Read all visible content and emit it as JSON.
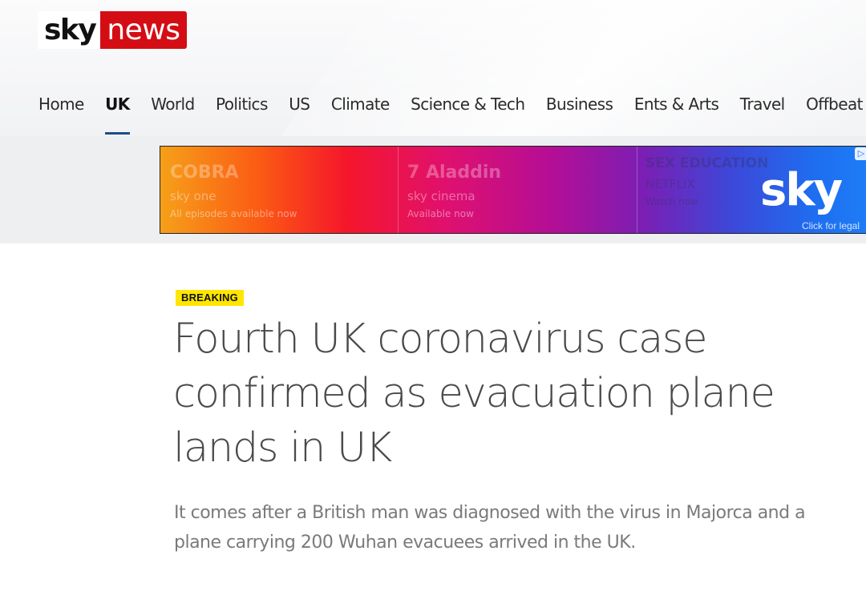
{
  "logo": {
    "part1": "sky",
    "part2": "news"
  },
  "nav": {
    "items": [
      {
        "label": "Home"
      },
      {
        "label": "UK"
      },
      {
        "label": "World"
      },
      {
        "label": "Politics"
      },
      {
        "label": "US"
      },
      {
        "label": "Climate"
      },
      {
        "label": "Science & Tech"
      },
      {
        "label": "Business"
      },
      {
        "label": "Ents & Arts"
      },
      {
        "label": "Travel"
      },
      {
        "label": "Offbeat"
      }
    ],
    "active": "UK"
  },
  "ad": {
    "panel1": {
      "title": "COBRA",
      "channel": "sky one",
      "note": "All episodes available now"
    },
    "panel2": {
      "title": "7 Aladdin",
      "channel": "sky cinema",
      "note": "Available now"
    },
    "panel3": {
      "title": "SEX EDUCATION",
      "channel": "NETFLIX",
      "note": "Watch now"
    },
    "brand": "sky",
    "legal": "Click for legal",
    "corner_icon": "adchoices-icon"
  },
  "article": {
    "badge": "BREAKING",
    "headline": "Fourth UK coronavirus case confirmed as evacuation plane lands in UK",
    "standfirst": "It comes after a British man was diagnosed with the virus in Majorca and a plane carrying 200 Wuhan evacuees arrived in the UK."
  },
  "colors": {
    "brand_red": "#d40d14",
    "nav_active_underline": "#1b4f8a",
    "breaking_badge": "#ffe600"
  }
}
